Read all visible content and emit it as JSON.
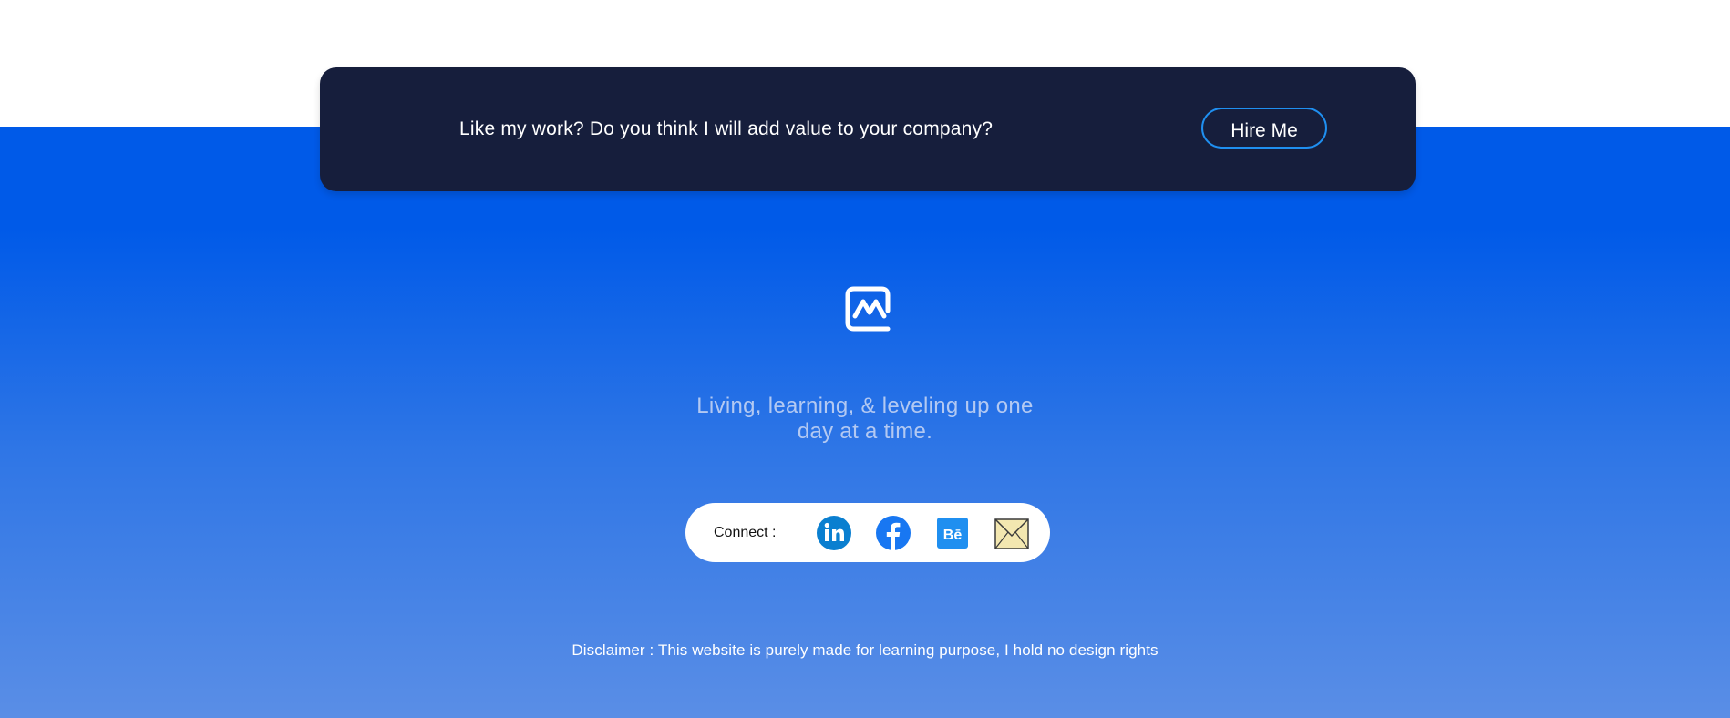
{
  "cta": {
    "text": "Like my work? Do you think I will add value to your company?",
    "button_label": "Hire Me"
  },
  "logo": {
    "icon": "monogram-m-icon"
  },
  "tagline": {
    "line1": "Living, learning, & leveling up one",
    "line2": "day at a time."
  },
  "connect": {
    "label": "Connect :",
    "links": [
      {
        "name": "LinkedIn",
        "icon": "linkedin-icon",
        "glyph": "in",
        "color": "#0a7fd0"
      },
      {
        "name": "Facebook",
        "icon": "facebook-icon",
        "glyph": "f",
        "color": "#1877f2"
      },
      {
        "name": "Behance",
        "icon": "behance-icon",
        "glyph": "Bē",
        "color": "#1f8ff0"
      },
      {
        "name": "Email",
        "icon": "envelope-icon",
        "color": "#f3e7b0"
      }
    ]
  },
  "disclaimer": {
    "text": "Disclaimer : This website is purely made for learning purpose, I hold no design rights"
  },
  "colors": {
    "footer_blue": "#005ae8",
    "card_dark": "#161e3c",
    "button_border": "#1f8ff0"
  }
}
